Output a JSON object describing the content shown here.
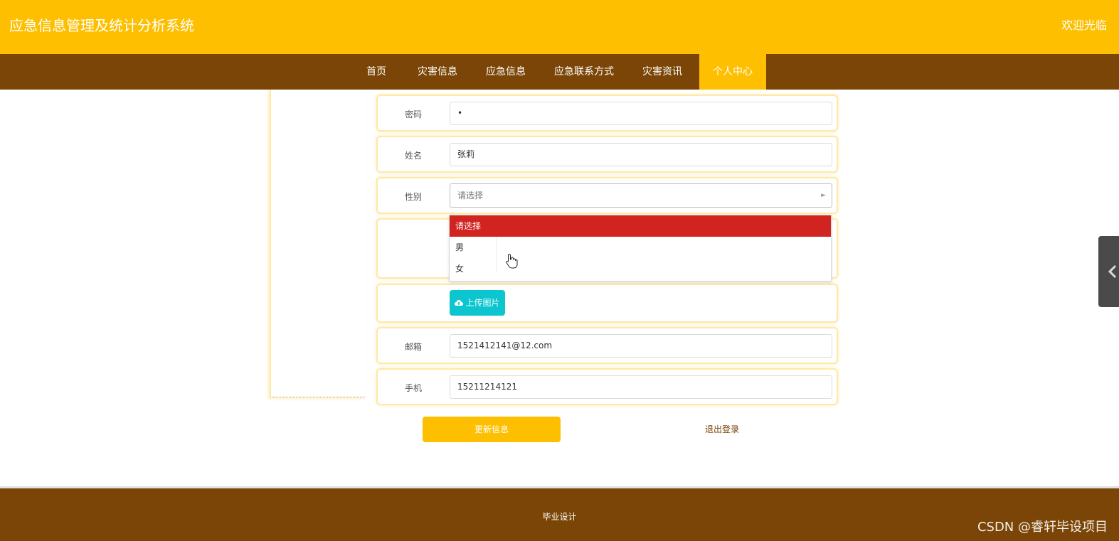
{
  "header": {
    "title": "应急信息管理及统计分析系统",
    "welcome": "欢迎光临"
  },
  "nav": {
    "items": [
      {
        "label": "首页"
      },
      {
        "label": "灾害信息"
      },
      {
        "label": "应急信息"
      },
      {
        "label": "应急联系方式"
      },
      {
        "label": "灾害资讯"
      },
      {
        "label": "个人中心",
        "active": true
      }
    ]
  },
  "form": {
    "password": {
      "label": "密码",
      "value": "•"
    },
    "name": {
      "label": "姓名",
      "value": "张莉"
    },
    "gender": {
      "label": "性别",
      "placeholder": "请选择",
      "options": [
        "请选择",
        "男",
        "女"
      ],
      "highlighted": "请选择"
    },
    "upload": {
      "label": "上传图片"
    },
    "email": {
      "label": "邮箱",
      "value": "1521412141@12.com"
    },
    "phone": {
      "label": "手机",
      "value": "15211214121"
    }
  },
  "actions": {
    "update": "更新信息",
    "logout": "退出登录"
  },
  "footer": {
    "text": "毕业设计",
    "watermark": "CSDN @睿轩毕设项目"
  },
  "colors": {
    "primary": "#fdbf00",
    "nav_bg": "#7a4506",
    "highlight": "#d12420",
    "upload": "#0cc6cf"
  }
}
